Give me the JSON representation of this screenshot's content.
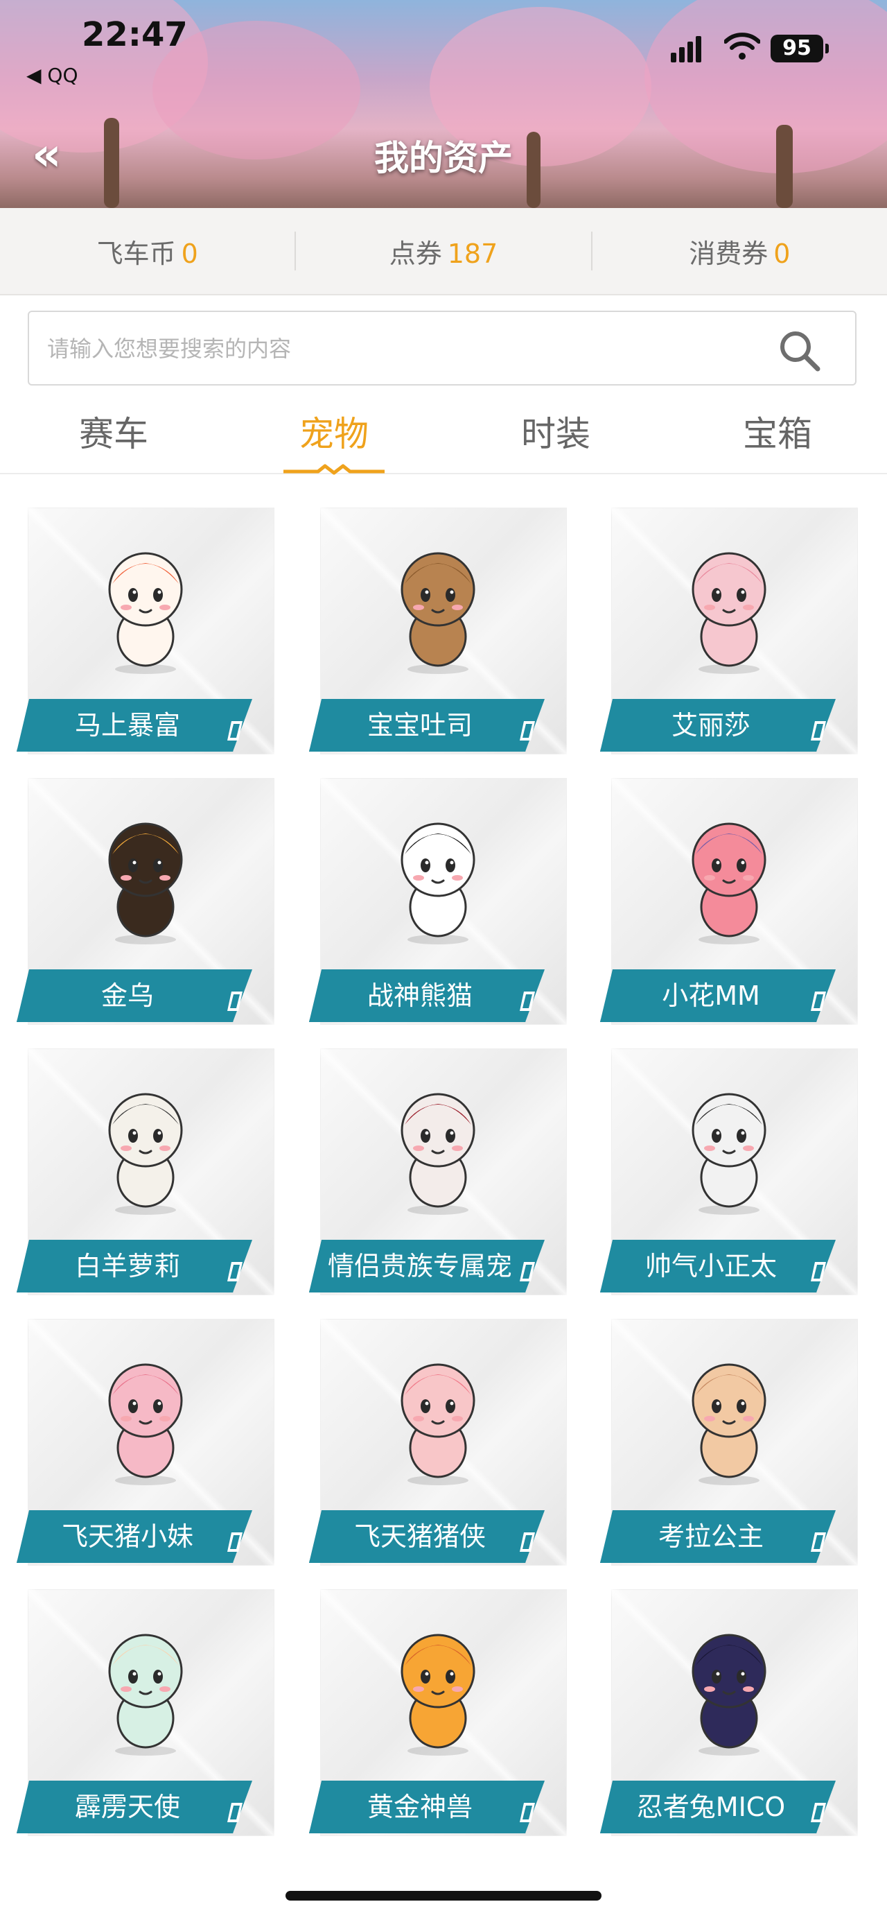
{
  "status_bar": {
    "time": "22:47",
    "back_app": "◀ QQ",
    "battery": "95"
  },
  "header": {
    "title": "我的资产",
    "back_glyph": "«"
  },
  "balances": [
    {
      "label": "飞车币",
      "value": "0"
    },
    {
      "label": "点券",
      "value": "187"
    },
    {
      "label": "消费券",
      "value": "0"
    }
  ],
  "search": {
    "placeholder": "请输入您想要搜索的内容"
  },
  "tabs": [
    {
      "label": "赛车"
    },
    {
      "label": "宠物"
    },
    {
      "label": "时装"
    },
    {
      "label": "宝箱"
    }
  ],
  "active_tab": "宠物",
  "pets": [
    {
      "name": "马上暴富"
    },
    {
      "name": "宝宝吐司"
    },
    {
      "name": "艾丽莎"
    },
    {
      "name": "金乌"
    },
    {
      "name": "战神熊猫"
    },
    {
      "name": "小花MM"
    },
    {
      "name": "白羊萝莉"
    },
    {
      "name": "情侣贵族专属宠"
    },
    {
      "name": "帅气小正太"
    },
    {
      "name": "飞天猪小妹"
    },
    {
      "name": "飞天猪猪侠"
    },
    {
      "name": "考拉公主"
    },
    {
      "name": "霹雳天使"
    },
    {
      "name": "黄金神兽"
    },
    {
      "name": "忍者兔MICO"
    }
  ],
  "colors": {
    "accent": "#efa21c",
    "label_bar": "#1f8ba0",
    "muted_text": "#6b6b6b"
  }
}
